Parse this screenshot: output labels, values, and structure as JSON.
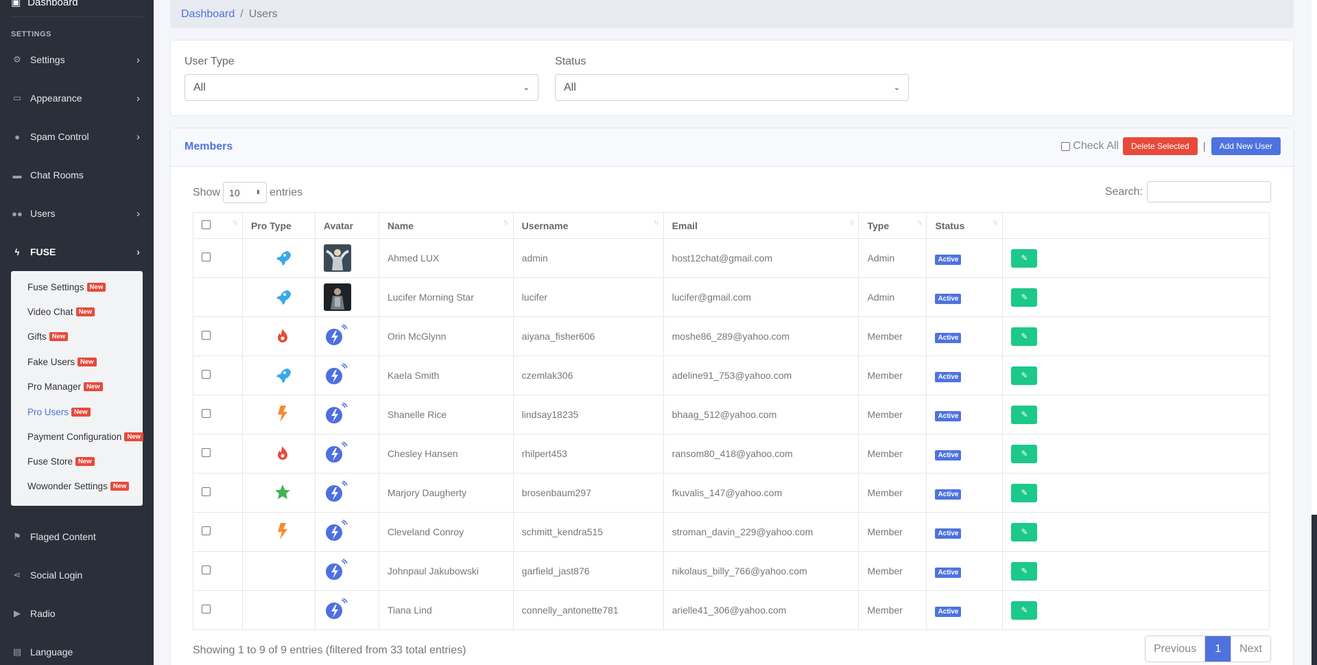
{
  "sidebar": {
    "top_item": "Dashboard",
    "section_heading": "SETTINGS",
    "items": [
      {
        "label": "Settings",
        "icon": "gear-icon",
        "has_chevron": true
      },
      {
        "label": "Appearance",
        "icon": "card-icon",
        "has_chevron": true
      },
      {
        "label": "Spam Control",
        "icon": "user-secret-icon",
        "has_chevron": true
      },
      {
        "label": "Chat Rooms",
        "icon": "comments-icon",
        "has_chevron": false
      },
      {
        "label": "Users",
        "icon": "users-icon",
        "has_chevron": true
      },
      {
        "label": "FUSE",
        "icon": "bolt-icon",
        "has_chevron": true
      },
      {
        "label": "Flaged Content",
        "icon": "flag-icon",
        "has_chevron": false
      },
      {
        "label": "Social Login",
        "icon": "share-icon",
        "has_chevron": false
      },
      {
        "label": "Radio",
        "icon": "play-circle-icon",
        "has_chevron": false
      },
      {
        "label": "Language",
        "icon": "language-icon",
        "has_chevron": false
      }
    ],
    "fuse_submenu": [
      {
        "label": "Fuse Settings",
        "badge": "New"
      },
      {
        "label": "Video Chat",
        "badge": "New"
      },
      {
        "label": "Gifts",
        "badge": "New"
      },
      {
        "label": "Fake Users",
        "badge": "New"
      },
      {
        "label": "Pro Manager",
        "badge": "New"
      },
      {
        "label": "Pro Users",
        "badge": "New"
      },
      {
        "label": "Payment Configuration",
        "badge": "New"
      },
      {
        "label": "Fuse Store",
        "badge": "New"
      },
      {
        "label": "Wowonder Settings",
        "badge": "New"
      }
    ]
  },
  "breadcrumb": {
    "home": "Dashboard",
    "separator": "/",
    "current": "Users"
  },
  "filters": {
    "user_type": {
      "label": "User Type",
      "value": "All"
    },
    "status": {
      "label": "Status",
      "value": "All"
    }
  },
  "members": {
    "title": "Members",
    "check_all_label": "Check All",
    "delete_label": "Delete Selected",
    "pipe": "|",
    "add_label": "Add New User",
    "show_label": "Show",
    "entries_value": "10",
    "entries_label": "entries",
    "search_label": "Search:",
    "columns": [
      "",
      "Pro Type",
      "Avatar",
      "Name",
      "Username",
      "Email",
      "Type",
      "Status",
      ""
    ],
    "rows": [
      {
        "checkbox": true,
        "pro": "rocket",
        "avatar": "photo-angel",
        "name": "Ahmed LUX",
        "username": "admin",
        "email": "host12chat@gmail.com",
        "type": "Admin",
        "status": "Active"
      },
      {
        "checkbox": false,
        "pro": "rocket",
        "avatar": "photo-dark",
        "name": "Lucifer Morning Star",
        "username": "lucifer",
        "email": "lucifer@gmail.com",
        "type": "Admin",
        "status": "Active"
      },
      {
        "checkbox": true,
        "pro": "fire",
        "avatar": "default",
        "name": "Orin McGlynn",
        "username": "aiyana_fisher606",
        "email": "moshe86_289@yahoo.com",
        "type": "Member",
        "status": "Active"
      },
      {
        "checkbox": true,
        "pro": "rocket",
        "avatar": "default",
        "name": "Kaela Smith",
        "username": "czemlak306",
        "email": "adeline91_753@yahoo.com",
        "type": "Member",
        "status": "Active"
      },
      {
        "checkbox": true,
        "pro": "bolt",
        "avatar": "default",
        "name": "Shanelle Rice",
        "username": "lindsay18235",
        "email": "bhaag_512@yahoo.com",
        "type": "Member",
        "status": "Active"
      },
      {
        "checkbox": true,
        "pro": "fire",
        "avatar": "default",
        "name": "Chesley Hansen",
        "username": "rhilpert453",
        "email": "ransom80_418@yahoo.com",
        "type": "Member",
        "status": "Active"
      },
      {
        "checkbox": true,
        "pro": "star",
        "avatar": "default",
        "name": "Marjory Daugherty",
        "username": "brosenbaum297",
        "email": "fkuvalis_147@yahoo.com",
        "type": "Member",
        "status": "Active"
      },
      {
        "checkbox": true,
        "pro": "bolt",
        "avatar": "default",
        "name": "Cleveland Conroy",
        "username": "schmitt_kendra515",
        "email": "stroman_davin_229@yahoo.com",
        "type": "Member",
        "status": "Active"
      },
      {
        "checkbox": true,
        "pro": "",
        "avatar": "default",
        "name": "Johnpaul Jakubowski",
        "username": "garfield_jast876",
        "email": "nikolaus_billy_766@yahoo.com",
        "type": "Member",
        "status": "Active"
      },
      {
        "checkbox": true,
        "pro": "",
        "avatar": "default",
        "name": "Tiana Lind",
        "username": "connelly_antonette781",
        "email": "arielle41_306@yahoo.com",
        "type": "Member",
        "status": "Active"
      }
    ],
    "info": "Showing 1 to 9 of 9 entries (filtered from 33 total entries)",
    "pager": {
      "prev": "Previous",
      "page": "1",
      "next": "Next"
    }
  },
  "colors": {
    "accent": "#4e73df",
    "danger": "#e74a3b",
    "success": "#1cc88a",
    "sidebar_bg": "#2b2f3a"
  }
}
